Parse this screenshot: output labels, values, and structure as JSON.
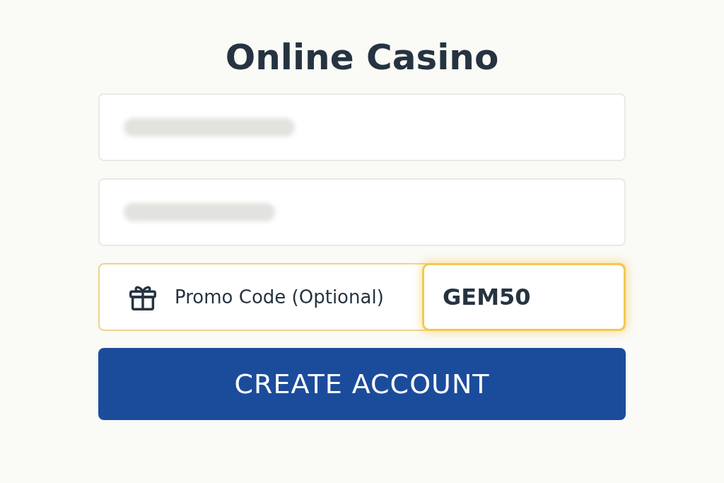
{
  "title": "Online Casino",
  "fields": [
    {
      "kind": "blurred"
    },
    {
      "kind": "blurred"
    }
  ],
  "promo": {
    "label": "Promo Code (Optional)",
    "value": "GEM50",
    "focused": true
  },
  "button": {
    "label": "CREATE ACCOUNT"
  }
}
